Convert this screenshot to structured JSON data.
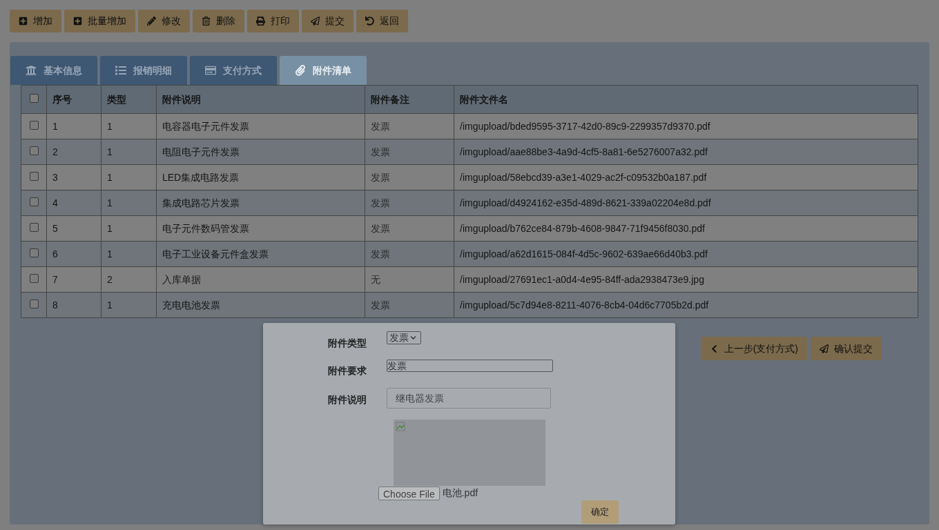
{
  "toolbar": [
    {
      "label": "增加",
      "kind": "add"
    },
    {
      "label": "批量增加",
      "kind": "add"
    },
    {
      "label": "修改",
      "kind": "edit"
    },
    {
      "label": "删除",
      "kind": "delete"
    },
    {
      "label": "打印",
      "kind": "print"
    },
    {
      "label": "提交",
      "kind": "send"
    },
    {
      "label": "返回",
      "kind": "back"
    }
  ],
  "tabs": [
    {
      "label": "基本信息",
      "kind": "bank",
      "selected": false
    },
    {
      "label": "报销明细",
      "kind": "list",
      "selected": false
    },
    {
      "label": "支付方式",
      "kind": "card",
      "selected": false
    },
    {
      "label": "附件清单",
      "kind": "clip",
      "selected": true
    }
  ],
  "table": {
    "all_checked": false,
    "columns": [
      "序号",
      "类型",
      "附件说明",
      "附件备注",
      "附件文件名"
    ],
    "rows": [
      {
        "checked": false,
        "cells": [
          "1",
          "1",
          "电容器电子元件发票",
          "发票",
          "/imgupload/bded9595-3717-42d0-89c9-2299357d9370.pdf"
        ]
      },
      {
        "checked": false,
        "cells": [
          "2",
          "1",
          "电阻电子元件发票",
          "发票",
          "/imgupload/aae88be3-4a9d-4cf5-8a81-6e5276007a32.pdf"
        ]
      },
      {
        "checked": false,
        "cells": [
          "3",
          "1",
          "LED集成电路发票",
          "发票",
          "/imgupload/58ebcd39-a3e1-4029-ac2f-c09532b0a187.pdf"
        ]
      },
      {
        "checked": false,
        "cells": [
          "4",
          "1",
          "集成电路芯片发票",
          "发票",
          "/imgupload/d4924162-e35d-489d-8621-339a02204e8d.pdf"
        ]
      },
      {
        "checked": false,
        "cells": [
          "5",
          "1",
          "电子元件数码管发票",
          "发票",
          "/imgupload/b762ce84-879b-4608-9847-71f9456f8030.pdf"
        ]
      },
      {
        "checked": false,
        "cells": [
          "6",
          "1",
          "电子工业设备元件盒发票",
          "发票",
          "/imgupload/a62d1615-084f-4d5c-9602-639ae66d40b3.pdf"
        ]
      },
      {
        "checked": false,
        "cells": [
          "7",
          "2",
          "入库单据",
          "无",
          "/imgupload/27691ec1-a0d4-4e95-84ff-ada2938473e9.jpg"
        ]
      },
      {
        "checked": false,
        "cells": [
          "8",
          "1",
          "充电电池发票",
          "发票",
          "/imgupload/5c7d94e8-8211-4076-8cb4-04d6c7705b2d.pdf"
        ]
      }
    ]
  },
  "footer_buttons": [
    {
      "label": "上一步(支付方式)",
      "kind": "prev"
    },
    {
      "label": "确认提交",
      "kind": "send"
    }
  ],
  "dialog": {
    "fields": [
      {
        "label": "附件类型",
        "kind": "select",
        "value": "发票"
      },
      {
        "label": "附件要求",
        "kind": "textarea",
        "value": "发票"
      },
      {
        "label": "附件说明",
        "kind": "input",
        "value": "继电器发票"
      }
    ],
    "file": {
      "button": "Choose File",
      "filename": "电池.pdf"
    },
    "confirm": "确定"
  }
}
